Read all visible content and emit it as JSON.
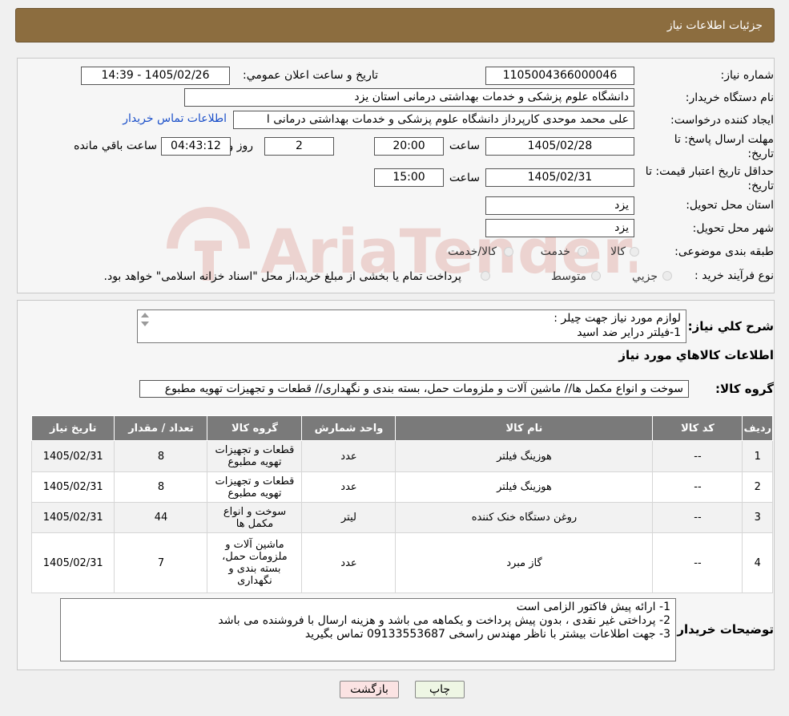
{
  "header": {
    "title": "جزئیات اطلاعات نیاز"
  },
  "form": {
    "need_number": {
      "label": "شماره نیاز:",
      "value": "1105004366000046"
    },
    "announce": {
      "label": "تاریخ و ساعت اعلان عمومي:",
      "value": "1405/02/26 - 14:39"
    },
    "buyer_org": {
      "label": "نام دستگاه خریدار:",
      "value": "دانشگاه علوم پزشکی و خدمات بهداشتی  درمانی استان یزد"
    },
    "requester": {
      "label": "ایجاد کننده درخواست:",
      "value": "علی محمد موحدی کارپرداز دانشگاه علوم پزشکی و خدمات بهداشتی  درمانی ا",
      "contact_link": "اطلاعات تماس خریدار"
    },
    "reply_deadline": {
      "label_line1": "مهلت ارسال پاسخ: تا",
      "label_line2": "تاریخ:",
      "date": "1405/02/28",
      "time_label": "ساعت",
      "time": "20:00",
      "days": "2",
      "days_label": "روز و",
      "remaining": "04:43:12",
      "remaining_label": "ساعت باقي مانده"
    },
    "price_validity": {
      "label_line1": "حداقل تاریخ اعتبار قیمت: تا",
      "label_line2": "تاریخ:",
      "date": "1405/02/31",
      "time_label": "ساعت",
      "time": "15:00"
    },
    "province": {
      "label": "استان محل تحویل:",
      "value": "یزد"
    },
    "city": {
      "label": "شهر محل تحویل:",
      "value": "یزد"
    },
    "category": {
      "label": "طبقه بندی موضوعی:",
      "options": [
        "کالا",
        "خدمت",
        "کالا/خدمت"
      ]
    },
    "process": {
      "label": "نوع فرآیند خرید :",
      "options": [
        "جزیي",
        "متوسط"
      ],
      "note": "پرداخت تمام یا بخشی از مبلغ خرید،از محل \"اسناد خزانه اسلامی\" خواهد بود."
    }
  },
  "summary": {
    "label": "شرح کلي نیاز:",
    "lines": [
      "لوازم مورد نیاز جهت چیلر :",
      "1-فیلتر درایر ضد اسید"
    ]
  },
  "goods_section": {
    "title": "اطلاعات کالاهاي مورد نیاز",
    "group_label": "گروه کالا:",
    "group_value": "سوخت و انواع مکمل ها// ماشین آلات و ملزومات حمل، بسته بندی و نگهداری//  قطعات و تجهیزات تهویه مطبوع"
  },
  "table": {
    "headers": [
      "ردیف",
      "کد کالا",
      "نام کالا",
      "واحد شمارش",
      "گروه کالا",
      "تعداد / مقدار",
      "تاریخ نیاز"
    ],
    "rows": [
      {
        "row": "1",
        "code": "--",
        "name": "هوزینگ فیلتر",
        "unit": "عدد",
        "group": "قطعات و تجهیزات تهویه مطبوع",
        "qty": "8",
        "date": "1405/02/31"
      },
      {
        "row": "2",
        "code": "--",
        "name": "هوزینگ فیلتر",
        "unit": "عدد",
        "group": "قطعات و تجهیزات تهویه مطبوع",
        "qty": "8",
        "date": "1405/02/31"
      },
      {
        "row": "3",
        "code": "--",
        "name": "روغن دستگاه خنک کننده",
        "unit": "لیتر",
        "group": "سوخت و انواع مکمل ها",
        "qty": "44",
        "date": "1405/02/31"
      },
      {
        "row": "4",
        "code": "--",
        "name": "گاز مبرد",
        "unit": "عدد",
        "group": "ماشین آلات و ملزومات حمل، بسته بندی و نگهداری",
        "qty": "7",
        "date": "1405/02/31"
      }
    ]
  },
  "buyer_notes": {
    "label": "توضیحات خریدار:",
    "lines": [
      "1- ارائه پیش فاکتور الزامی است",
      "2- پرداختی غیر نقدی ، بدون پیش پرداخت و یکماهه می باشد و هزینه ارسال با فروشنده می باشد",
      "3- جهت اطلاعات بیشتر با ناظر مهندس راسخی 09133553687 تماس بگیرید"
    ]
  },
  "buttons": {
    "print": "چاپ",
    "back": "بازگشت"
  },
  "watermark": {
    "text": "AriaTender.neT"
  }
}
